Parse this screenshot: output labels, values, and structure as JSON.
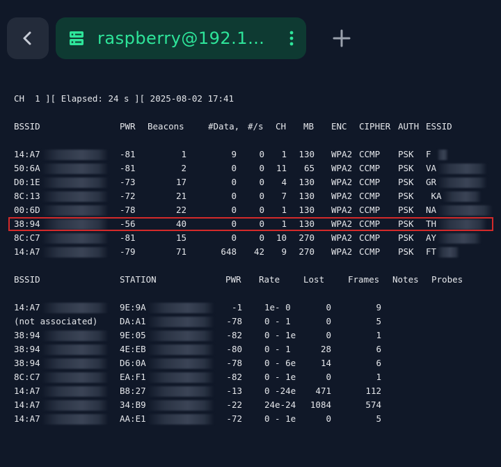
{
  "tab": {
    "title": "raspberry@192.168.1.2",
    "title_display": "raspberry@192.16…"
  },
  "icons": {
    "back": "chevron-left-icon",
    "server": "server-icon",
    "menu": "kebab-menu-icon",
    "add": "plus-icon"
  },
  "colors": {
    "background": "#101828",
    "tab_bg": "#0e3a32",
    "tab_text": "#2ee59a",
    "highlight": "#d42a2a"
  },
  "status_line": "CH  1 ][ Elapsed: 24 s ][ 2025-08-02 17:41",
  "ap_table": {
    "headers": [
      "BSSID",
      "PWR",
      "Beacons",
      "#Data,",
      "#/s",
      "CH",
      "MB",
      "ENC",
      "CIPHER",
      "AUTH",
      "ESSID"
    ],
    "rows": [
      {
        "bssid": "14:A7",
        "pwr": "-81",
        "beacons": "1",
        "data": "9",
        "ps": "0",
        "ch": "1",
        "mb": "130",
        "enc": "WPA2",
        "cipher": "CCMP",
        "auth": "PSK",
        "essid": "F"
      },
      {
        "bssid": "50:6A",
        "pwr": "-81",
        "beacons": "2",
        "data": "0",
        "ps": "0",
        "ch": "11",
        "mb": "65",
        "enc": "WPA2",
        "cipher": "CCMP",
        "auth": "PSK",
        "essid": "VA"
      },
      {
        "bssid": "D0:1E",
        "pwr": "-73",
        "beacons": "17",
        "data": "0",
        "ps": "0",
        "ch": "4",
        "mb": "130",
        "enc": "WPA2",
        "cipher": "CCMP",
        "auth": "PSK",
        "essid": "GR"
      },
      {
        "bssid": "8C:13",
        "pwr": "-72",
        "beacons": "21",
        "data": "0",
        "ps": "0",
        "ch": "7",
        "mb": "130",
        "enc": "WPA2",
        "cipher": "CCMP",
        "auth": "PSK",
        "essid": " KA"
      },
      {
        "bssid": "00:6D",
        "pwr": "-78",
        "beacons": "22",
        "data": "0",
        "ps": "0",
        "ch": "1",
        "mb": "130",
        "enc": "WPA2",
        "cipher": "CCMP",
        "auth": "PSK",
        "essid": "NA"
      },
      {
        "bssid": "38:94",
        "pwr": "-56",
        "beacons": "40",
        "data": "0",
        "ps": "0",
        "ch": "1",
        "mb": "130",
        "enc": "WPA2",
        "cipher": "CCMP",
        "auth": "PSK",
        "essid": "TH"
      },
      {
        "bssid": "8C:C7",
        "pwr": "-81",
        "beacons": "15",
        "data": "0",
        "ps": "0",
        "ch": "10",
        "mb": "270",
        "enc": "WPA2",
        "cipher": "CCMP",
        "auth": "PSK",
        "essid": "AY"
      },
      {
        "bssid": "14:A7",
        "pwr": "-79",
        "beacons": "71",
        "data": "648",
        "ps": "42",
        "ch": "9",
        "mb": "270",
        "enc": "WPA2",
        "cipher": "CCMP",
        "auth": "PSK",
        "essid": "FT"
      }
    ]
  },
  "station_table": {
    "headers": [
      "BSSID",
      "STATION",
      "PWR",
      "Rate",
      "Lost",
      "Frames",
      "Notes",
      "Probes"
    ],
    "rows": [
      {
        "bssid": "14:A7",
        "station": "9E:9A",
        "pwr": "-1",
        "rate": "1e- 0",
        "lost": "0",
        "frames": "9"
      },
      {
        "bssid": "(not associated)",
        "station": "DA:A1",
        "pwr": "-78",
        "rate": "0 - 1",
        "lost": "0",
        "frames": "5"
      },
      {
        "bssid": "38:94",
        "station": "9E:05",
        "pwr": "-82",
        "rate": "0 - 1e",
        "lost": "0",
        "frames": "1"
      },
      {
        "bssid": "38:94",
        "station": "4E:EB",
        "pwr": "-80",
        "rate": "0 - 1",
        "lost": "28",
        "frames": "6"
      },
      {
        "bssid": "38:94",
        "station": "D6:0A",
        "pwr": "-78",
        "rate": "0 - 6e",
        "lost": "14",
        "frames": "6"
      },
      {
        "bssid": "8C:C7",
        "station": "EA:F1",
        "pwr": "-82",
        "rate": "0 - 1e",
        "lost": "0",
        "frames": "1"
      },
      {
        "bssid": "14:A7",
        "station": "B8:27",
        "pwr": "-13",
        "rate": "0 -24e",
        "lost": "471",
        "frames": "112"
      },
      {
        "bssid": "14:A7",
        "station": "34:B9",
        "pwr": "-22",
        "rate": "24e-24",
        "lost": "1084",
        "frames": "574"
      },
      {
        "bssid": "14:A7",
        "station": "AA:E1",
        "pwr": "-72",
        "rate": "0 - 1e",
        "lost": "0",
        "frames": "5"
      }
    ]
  }
}
